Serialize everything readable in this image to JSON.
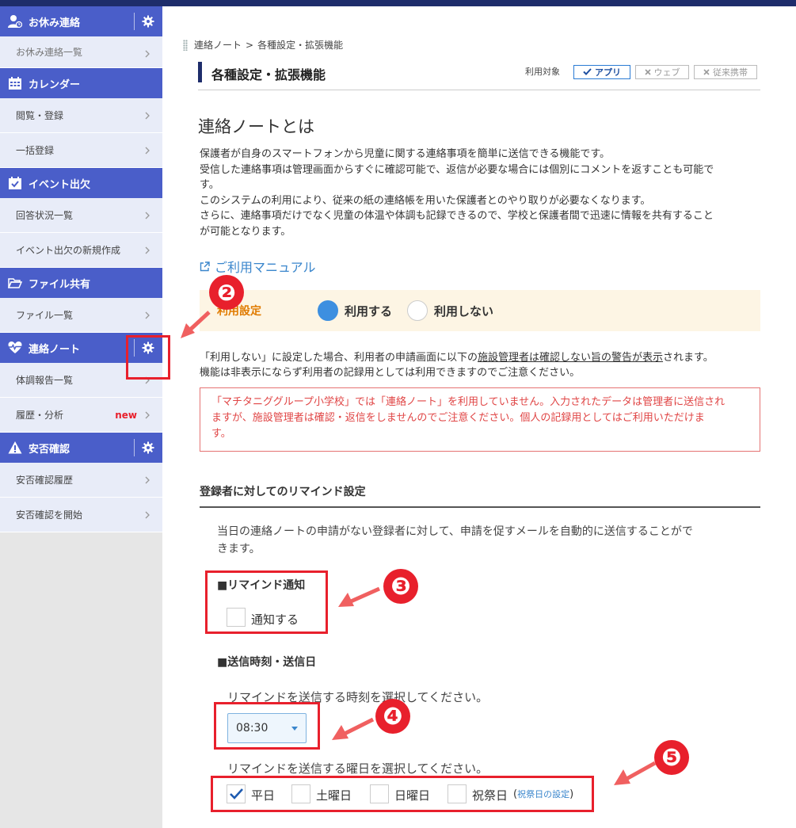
{
  "sidebar": {
    "sections": [
      {
        "title": "お休み連絡",
        "icon": "user-clock-icon",
        "has_gear": true,
        "items": [
          {
            "label": "お休み連絡一覧"
          }
        ]
      },
      {
        "title": "カレンダー",
        "icon": "calendar-icon",
        "has_gear": false,
        "items": [
          {
            "label": "閲覧・登録"
          },
          {
            "label": "一括登録"
          }
        ]
      },
      {
        "title": "イベント出欠",
        "icon": "calendar-check-icon",
        "has_gear": false,
        "items": [
          {
            "label": "回答状況一覧"
          },
          {
            "label": "イベント出欠の新規作成"
          }
        ]
      },
      {
        "title": "ファイル共有",
        "icon": "folder-open-icon",
        "has_gear": false,
        "items": [
          {
            "label": "ファイル一覧"
          }
        ]
      },
      {
        "title": "連絡ノート",
        "icon": "heartbeat-icon",
        "has_gear": true,
        "items": [
          {
            "label": "体調報告一覧"
          },
          {
            "label": "履歴・分析",
            "badge": "new"
          }
        ]
      },
      {
        "title": "安否確認",
        "icon": "warning-icon",
        "has_gear": true,
        "items": [
          {
            "label": "安否確認履歴"
          },
          {
            "label": "安否確認を開始"
          }
        ]
      }
    ]
  },
  "breadcrumb": {
    "parent": "連絡ノート",
    "separator": ">",
    "current": "各種設定・拡張機能"
  },
  "page": {
    "title": "各種設定・拡張機能",
    "target_label": "利用対象",
    "targets": [
      {
        "label": "アプリ",
        "active": true
      },
      {
        "label": "ウェブ",
        "active": false
      },
      {
        "label": "従来携帯",
        "active": false
      }
    ]
  },
  "about": {
    "heading": "連絡ノートとは",
    "lines": [
      "保護者が自身のスマートフォンから児童に関する連絡事項を簡単に送信できる機能です。",
      "受信した連絡事項は管理画面からすぐに確認可能で、返信が必要な場合には個別にコメントを返すことも可能で",
      "す。",
      "このシステムの利用により、従来の紙の連絡帳を用いた保護者とのやり取りが必要なくなります。",
      "さらに、連絡事項だけでなく児童の体温や体調も記録できるので、学校と保護者間で迅速に情報を共有すること",
      "が可能となります。"
    ],
    "manual_link": "ご利用マニュアル"
  },
  "usage": {
    "label": "利用設定",
    "options": [
      {
        "label": "利用する",
        "selected": true
      },
      {
        "label": "利用しない",
        "selected": false
      }
    ]
  },
  "note": {
    "line1_pre": "「利用しない」に設定した場合、利用者の申請画面に以下の",
    "line1_underlined": "施設管理者は確認しない旨の警告が表示",
    "line1_post": "されます。",
    "line2": "機能は非表示にならず利用者の記録用としては利用できますのでご注意ください。"
  },
  "warning": {
    "lines": [
      "「マチタニググループ小学校」では「連絡ノート」を利用していません。入力されたデータは管理者に送信され",
      "ますが、施設管理者は確認・返信をしませんのでご注意ください。個人の記録用としてはご利用いただけま",
      "す。"
    ]
  },
  "remind": {
    "section_title": "登録者に対してのリマインド設定",
    "desc_lines": [
      "当日の連絡ノートの申請がない登録者に対して、申請を促すメールを自動的に送信することがで",
      "きます。"
    ],
    "notify_heading": "■リマインド通知",
    "notify_label": "通知する",
    "notify_checked": false,
    "time_heading": "■送信時刻・送信日",
    "time_prompt": "リマインドを送信する時刻を選択してください。",
    "time_value": "08:30",
    "day_prompt": "リマインドを送信する曜日を選択してください。",
    "days": [
      {
        "label": "平日",
        "checked": true
      },
      {
        "label": "土曜日",
        "checked": false
      },
      {
        "label": "日曜日",
        "checked": false
      },
      {
        "label": "祝祭日",
        "checked": false
      }
    ],
    "holiday_link_open": "(",
    "holiday_link": "祝祭日の設定",
    "holiday_link_close": ")"
  },
  "annotations": {
    "markers": [
      "❷",
      "❸",
      "❹",
      "❺"
    ]
  },
  "colors": {
    "topbar": "#1e2d6b",
    "sidebar_header": "#4a5ec9",
    "sidebar_item_bg": "#e8ecf8",
    "accent_red": "#e8202c",
    "link_blue": "#3a86cc",
    "usage_bg": "#fdf5e4",
    "usage_label": "#e07b00"
  }
}
